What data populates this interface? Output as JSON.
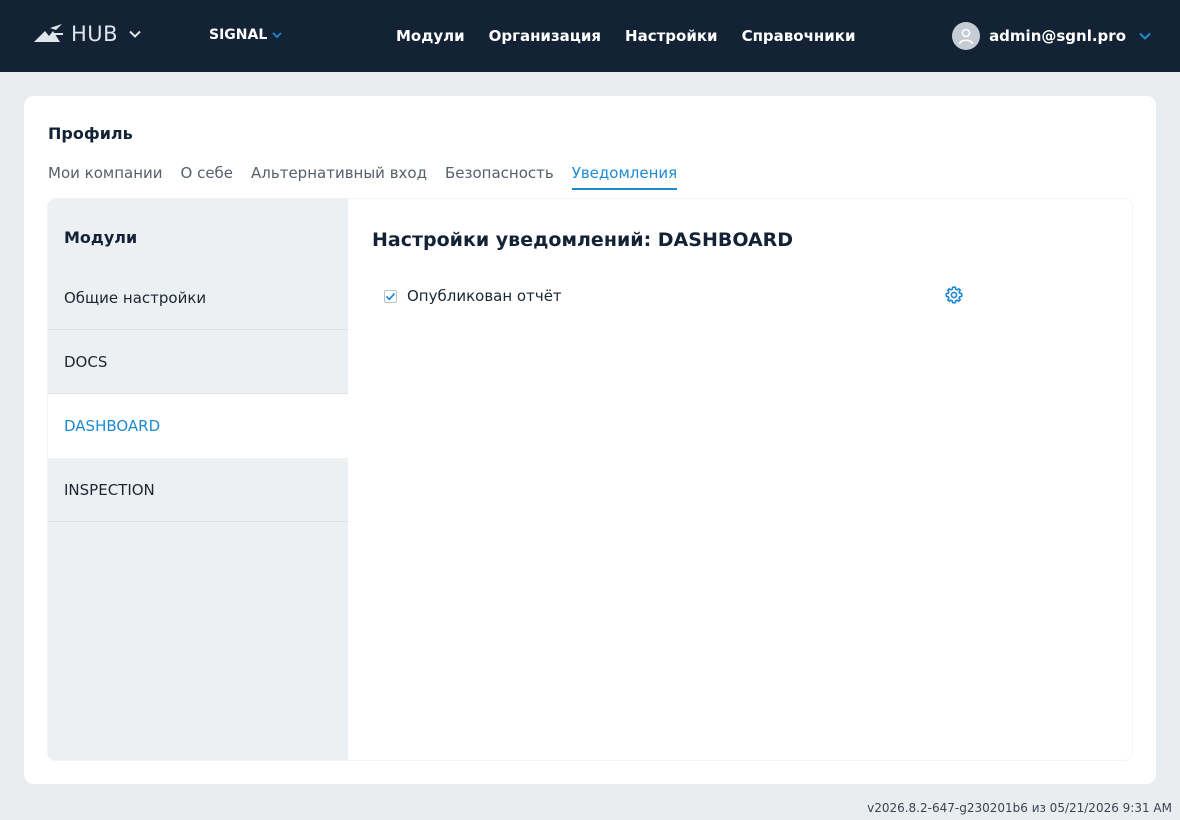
{
  "header": {
    "logo_text": "HUB",
    "app_name": "SIGNAL",
    "nav": [
      "Модули",
      "Организация",
      "Настройки",
      "Справочники"
    ],
    "user_email": "admin@sgnl.pro"
  },
  "profile": {
    "title": "Профиль",
    "tabs": [
      "Мои компании",
      "О себе",
      "Альтернативный вход",
      "Безопасность",
      "Уведомления"
    ],
    "active_tab": "Уведомления"
  },
  "sidebar": {
    "title": "Модули",
    "items": [
      "Общие настройки",
      "DOCS",
      "DASHBOARD",
      "INSPECTION"
    ],
    "active_item": "DASHBOARD"
  },
  "content": {
    "title": "Настройки уведомлений: DASHBOARD",
    "notifications": [
      {
        "label": "Опубликован отчёт",
        "checked": true
      }
    ]
  },
  "footer": {
    "version": "v2026.8.2-647-g230201b6 из 05/21/2026 9:31 AM"
  },
  "colors": {
    "topbar": "#132335",
    "accent": "#1e8ad2",
    "page_bg": "#e9edf0",
    "sidebar_bg": "#edf0f3"
  },
  "icons": [
    "hub-logo-icon",
    "chevron-down-icon",
    "user-avatar-icon",
    "checkmark-icon",
    "gear-icon"
  ]
}
